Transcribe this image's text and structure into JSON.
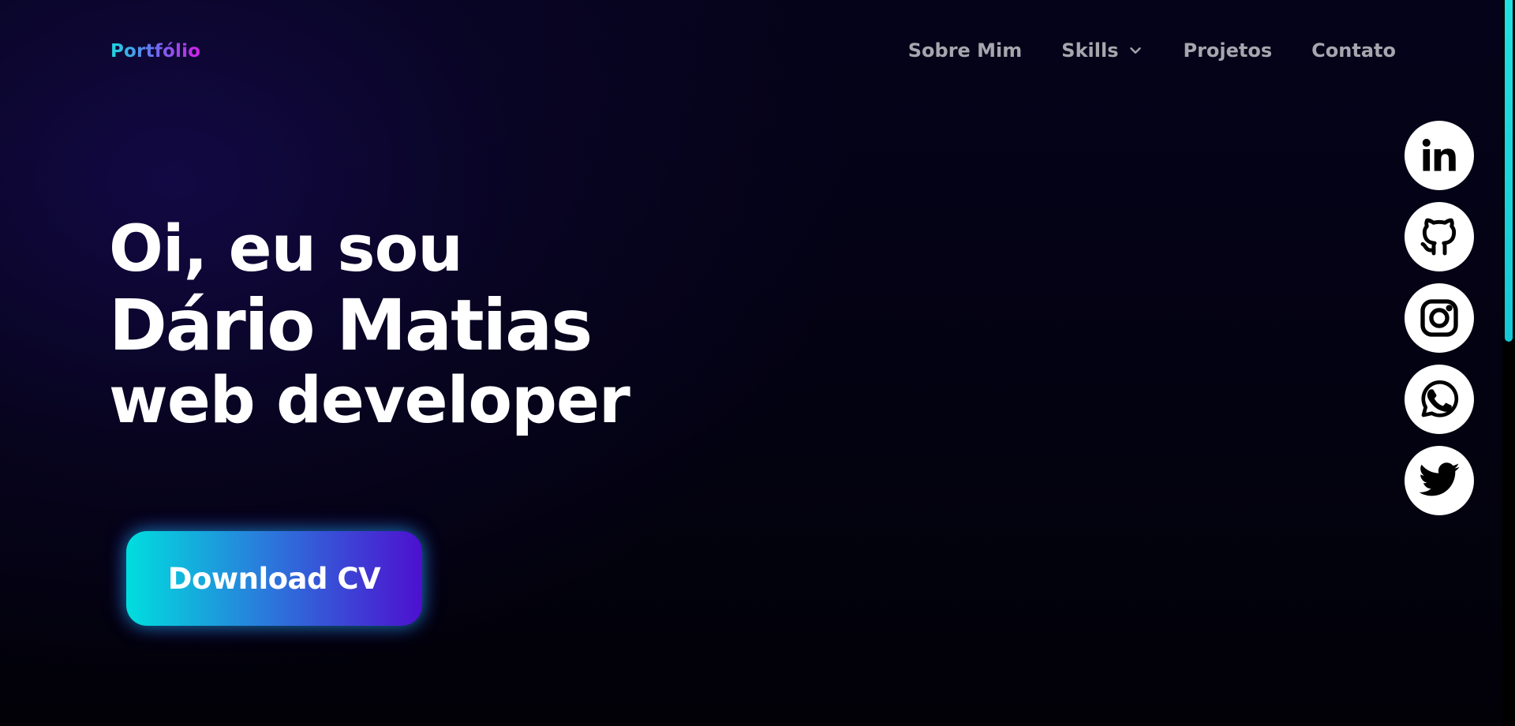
{
  "header": {
    "logo": "Portfólio",
    "nav": [
      {
        "label": "Sobre Mim",
        "has_dropdown": false
      },
      {
        "label": "Skills",
        "has_dropdown": true,
        "icon": "chevron-down-icon"
      },
      {
        "label": "Projetos",
        "has_dropdown": false
      },
      {
        "label": "Contato",
        "has_dropdown": false
      }
    ]
  },
  "hero": {
    "greeting": "Oi, eu sou",
    "name": "Dário Matias",
    "role": "web developer",
    "cta_label": "Download CV"
  },
  "social": [
    {
      "icon": "linkedin-icon"
    },
    {
      "icon": "github-icon"
    },
    {
      "icon": "instagram-icon"
    },
    {
      "icon": "whatsapp-icon"
    },
    {
      "icon": "twitter-icon"
    }
  ],
  "colors": {
    "background": "#020108",
    "logo_gradient": [
      "#1ed7e0",
      "#d61fe8"
    ],
    "nav_text": "#a6a6ae",
    "cta_gradient": [
      "#00dede",
      "#4d10cf"
    ],
    "scrollbar_thumb": "#1fe0e0"
  }
}
